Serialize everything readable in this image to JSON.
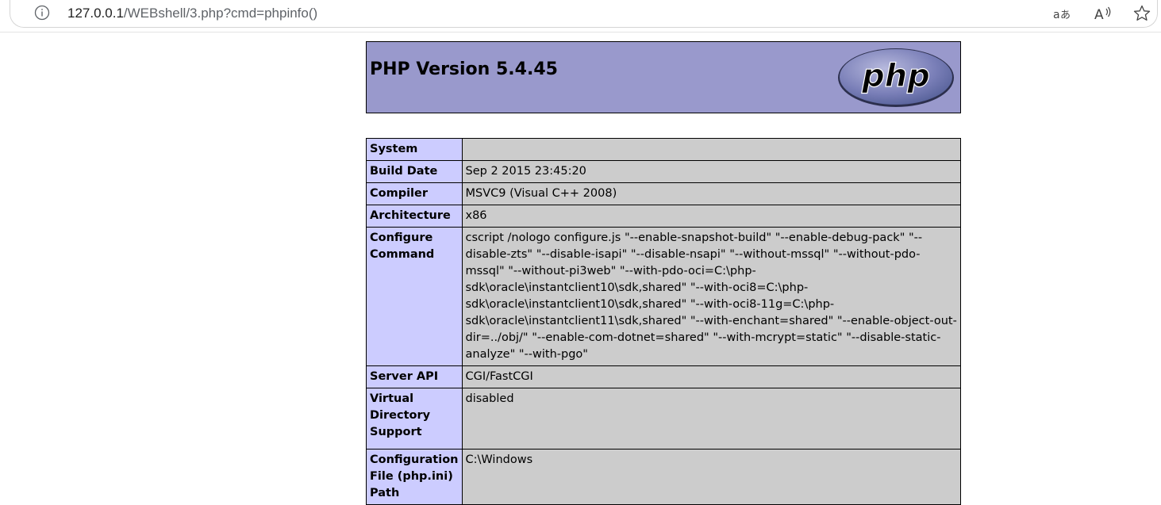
{
  "browser": {
    "url_host": "127.0.0.1",
    "url_path": "/WEBshell/3.php?cmd=phpinfo()",
    "icons": [
      "info-icon",
      "read-aloud-translate-icon",
      "read-aloud-icon",
      "favorite-star-icon"
    ]
  },
  "header": {
    "title": "PHP Version 5.4.45",
    "logo_text": "php"
  },
  "colors": {
    "header_bg": "#9999cc",
    "label_bg": "#ccccff",
    "value_bg": "#cccccc"
  },
  "rows": [
    {
      "label": "System",
      "value": ""
    },
    {
      "label": "Build Date",
      "value": "Sep 2 2015 23:45:20"
    },
    {
      "label": "Compiler",
      "value": "MSVC9 (Visual C++ 2008)"
    },
    {
      "label": "Architecture",
      "value": "x86"
    },
    {
      "label": "Configure Command",
      "value": "cscript /nologo configure.js \"--enable-snapshot-build\" \"--enable-debug-pack\" \"--disable-zts\" \"--disable-isapi\" \"--disable-nsapi\" \"--without-mssql\" \"--without-pdo-mssql\" \"--without-pi3web\" \"--with-pdo-oci=C:\\php-sdk\\oracle\\instantclient10\\sdk,shared\" \"--with-oci8=C:\\php-sdk\\oracle\\instantclient10\\sdk,shared\" \"--with-oci8-11g=C:\\php-sdk\\oracle\\instantclient11\\sdk,shared\" \"--with-enchant=shared\" \"--enable-object-out-dir=../obj/\" \"--enable-com-dotnet=shared\" \"--with-mcrypt=static\" \"--disable-static-analyze\" \"--with-pgo\""
    },
    {
      "label": "Server API",
      "value": "CGI/FastCGI"
    },
    {
      "label": "Virtual Directory Support",
      "value": "disabled"
    },
    {
      "label": "Configuration File (php.ini) Path",
      "value": "C:\\Windows"
    }
  ]
}
